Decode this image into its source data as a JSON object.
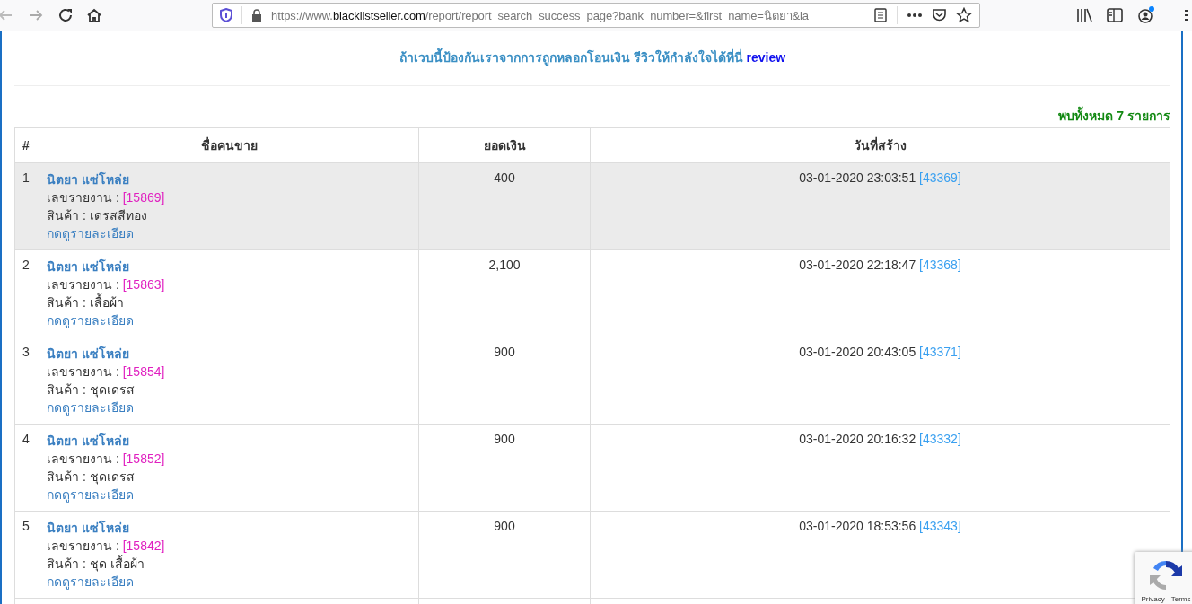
{
  "browser": {
    "url_host_prefix": "https://www.",
    "url_host": "blacklistseller.com",
    "url_rest": "/report/report_search_success_page?bank_number=&first_name=นิตยา&la"
  },
  "banner": {
    "text": "ถ้าเวบนี้ป้องกันเราจากการถูกหลอกโอนเงิน รีวิวให้กำลังใจได้ที่นี่",
    "link": "review"
  },
  "result_count": "พบทั้งหมด 7 รายการ",
  "table": {
    "columns": [
      "#",
      "ชื่อคนขาย",
      "ยอดเงิน",
      "วันที่สร้าง"
    ],
    "rows": [
      {
        "number": "1",
        "seller": "นิตยา แซ่โหล่ย",
        "report_label": "เลขรายงาน :",
        "report_id": "[15869]",
        "product": "สินค้า : เดรสสีทอง",
        "details_link": "กดดูรายละเอียด",
        "amount": "400",
        "created": "03-01-2020 23:03:51",
        "ref": "[43369]",
        "highlighted": true
      },
      {
        "number": "2",
        "seller": "นิตยา แซ่โหล่ย",
        "report_label": "เลขรายงาน :",
        "report_id": "[15863]",
        "product": "สินค้า : เสื้อผ้า",
        "details_link": "กดดูรายละเอียด",
        "amount": "2,100",
        "created": "03-01-2020 22:18:47",
        "ref": "[43368]",
        "highlighted": false
      },
      {
        "number": "3",
        "seller": "นิตยา แซ่โหล่ย",
        "report_label": "เลขรายงาน :",
        "report_id": "[15854]",
        "product": "สินค้า : ชุดเดรส",
        "details_link": "กดดูรายละเอียด",
        "amount": "900",
        "created": "03-01-2020 20:43:05",
        "ref": "[43371]",
        "highlighted": false
      },
      {
        "number": "4",
        "seller": "นิตยา แซ่โหล่ย",
        "report_label": "เลขรายงาน :",
        "report_id": "[15852]",
        "product": "สินค้า : ชุดเดรส",
        "details_link": "กดดูรายละเอียด",
        "amount": "900",
        "created": "03-01-2020 20:16:32",
        "ref": "[43332]",
        "highlighted": false
      },
      {
        "number": "5",
        "seller": "นิตยา แซ่โหล่ย",
        "report_label": "เลขรายงาน :",
        "report_id": "[15842]",
        "product": "สินค้า : ชุด เสื้อผ้า",
        "details_link": "กดดูรายละเอียด",
        "amount": "900",
        "created": "03-01-2020 18:53:56",
        "ref": "[43343]",
        "highlighted": false
      }
    ]
  },
  "recaptcha": {
    "text": "Privacy - Terms"
  }
}
